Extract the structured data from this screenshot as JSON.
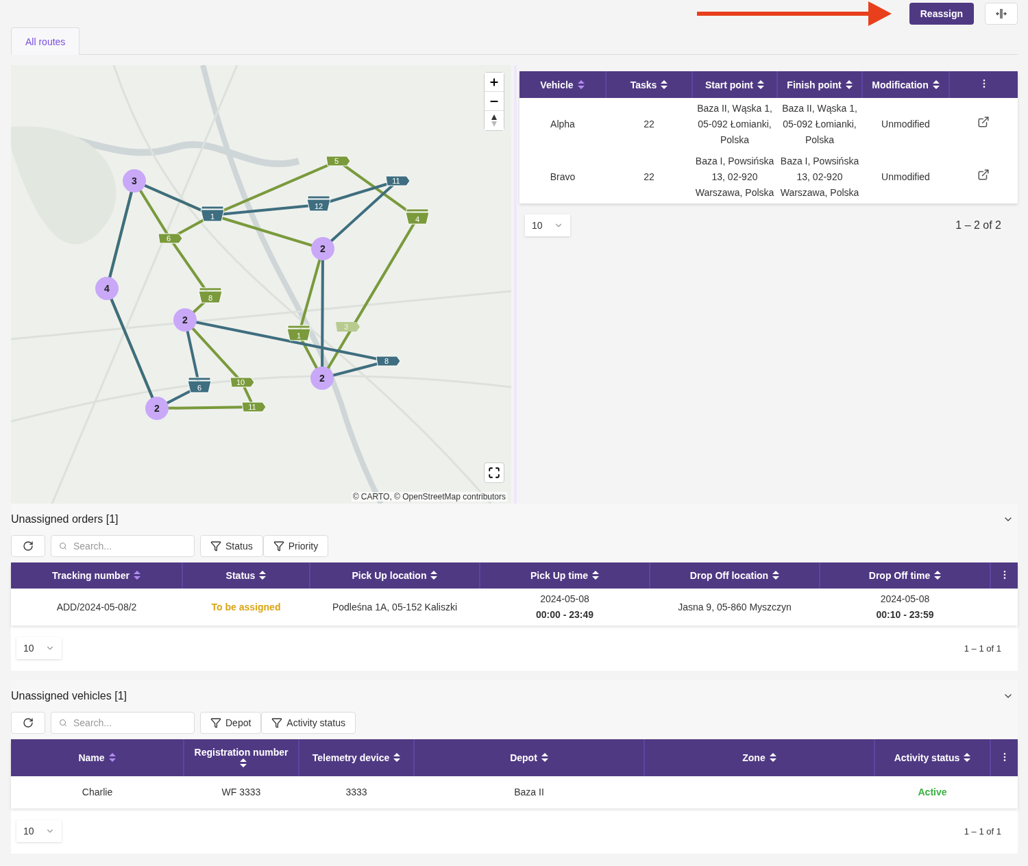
{
  "toolbar": {
    "primary_button": "Reassign"
  },
  "tabs": [
    {
      "label": "All routes",
      "selected": true
    }
  ],
  "map": {
    "routes": [
      {
        "color": "#7a9a3c"
      },
      {
        "color": "#3e6e7f"
      }
    ],
    "hubs": [
      {
        "label": "3"
      },
      {
        "label": "4"
      },
      {
        "label": "2"
      },
      {
        "label": "2"
      },
      {
        "label": "2"
      },
      {
        "label": "2"
      }
    ],
    "tasks": [
      {
        "label": "5",
        "kind": "flag",
        "color": "#7a9a3c",
        "dimmed": false
      },
      {
        "label": "4",
        "kind": "stack",
        "color": "#7a9a3c",
        "dimmed": false
      },
      {
        "label": "6",
        "kind": "flag",
        "color": "#7a9a3c",
        "dimmed": false
      },
      {
        "label": "8",
        "kind": "stack",
        "color": "#7a9a3c",
        "dimmed": false
      },
      {
        "label": "1",
        "kind": "stack",
        "color": "#7a9a3c",
        "dimmed": false
      },
      {
        "label": "10",
        "kind": "flag",
        "color": "#7a9a3c",
        "dimmed": false
      },
      {
        "label": "11",
        "kind": "flag",
        "color": "#7a9a3c",
        "dimmed": false
      },
      {
        "label": "3",
        "kind": "flag",
        "color": "#b7cb90",
        "dimmed": true
      },
      {
        "label": "1",
        "kind": "stack",
        "color": "#3e6e7f",
        "dimmed": false
      },
      {
        "label": "12",
        "kind": "stack",
        "color": "#3e6e7f",
        "dimmed": false
      },
      {
        "label": "11",
        "kind": "flag",
        "color": "#3e6e7f",
        "dimmed": false
      },
      {
        "label": "8",
        "kind": "flag",
        "color": "#3e6e7f",
        "dimmed": false
      },
      {
        "label": "6",
        "kind": "stack",
        "color": "#3e6e7f",
        "dimmed": false
      }
    ],
    "attribution": "© CARTO, © OpenStreetMap contributors"
  },
  "routes_table": {
    "columns": [
      {
        "label": "Vehicle",
        "sorted": true
      },
      {
        "label": "Tasks",
        "sorted": false
      },
      {
        "label": "Start point",
        "sorted": false
      },
      {
        "label": "Finish point",
        "sorted": false
      },
      {
        "label": "Modification",
        "sorted": false
      }
    ],
    "rows": [
      {
        "cells": [
          "Alpha",
          "22",
          "Baza II, Wąska 1, 05-092 Łomianki, Polska",
          "Baza II, Wąska 1, 05-092 Łomianki, Polska",
          "Unmodified"
        ]
      },
      {
        "cells": [
          "Bravo",
          "22",
          "Baza I, Powsińska 13, 02-920 Warszawa, Polska",
          "Baza I, Powsińska 13, 02-920 Warszawa, Polska",
          "Unmodified"
        ]
      }
    ],
    "page_size": "10",
    "range": "1 – 2 of 2"
  },
  "sections": [
    {
      "title": "Unassigned orders [1]",
      "expanded": true,
      "search_placeholder": "Search...",
      "filters": [
        "Status",
        "Priority"
      ],
      "columns": [
        {
          "label": "Tracking number",
          "sorted": true
        },
        {
          "label": "Status",
          "sorted": false
        },
        {
          "label": "Pick Up location",
          "sorted": false
        },
        {
          "label": "Pick Up time",
          "sorted": false
        },
        {
          "label": "Drop Off location",
          "sorted": false
        },
        {
          "label": "Drop Off time",
          "sorted": false
        }
      ],
      "rows": [
        {
          "cells": [
            {
              "kind": "text",
              "text": "ADD/2024-05-08/2"
            },
            {
              "kind": "status",
              "text": "To be assigned",
              "color": "#d9a514"
            },
            {
              "kind": "text",
              "text": "Podleśna 1A, 05-152 Kaliszki"
            },
            {
              "kind": "time",
              "date": "2024-05-08",
              "time": "00:00 - 23:49"
            },
            {
              "kind": "text",
              "text": "Jasna 9, 05-860 Myszczyn"
            },
            {
              "kind": "time",
              "date": "2024-05-08",
              "time": "00:10 - 23:59"
            }
          ]
        }
      ],
      "page_size": "10",
      "range": "1 – 1 of 1"
    },
    {
      "title": "Unassigned vehicles [1]",
      "expanded": true,
      "search_placeholder": "Search...",
      "filters": [
        "Depot",
        "Activity status"
      ],
      "columns": [
        {
          "label": "Name",
          "sorted": true
        },
        {
          "label": "Registration number",
          "sorted": false
        },
        {
          "label": "Telemetry device",
          "sorted": false
        },
        {
          "label": "Depot",
          "sorted": false
        },
        {
          "label": "Zone",
          "sorted": false
        },
        {
          "label": "Activity status",
          "sorted": false
        }
      ],
      "rows": [
        {
          "cells": [
            {
              "kind": "text",
              "text": "Charlie"
            },
            {
              "kind": "text",
              "text": "WF 3333"
            },
            {
              "kind": "text",
              "text": "3333"
            },
            {
              "kind": "text",
              "text": "Baza II"
            },
            {
              "kind": "empty"
            },
            {
              "kind": "status",
              "text": "Active",
              "color": "#3cb043"
            }
          ]
        }
      ],
      "page_size": "10",
      "range": "1 – 1 of 1"
    }
  ]
}
